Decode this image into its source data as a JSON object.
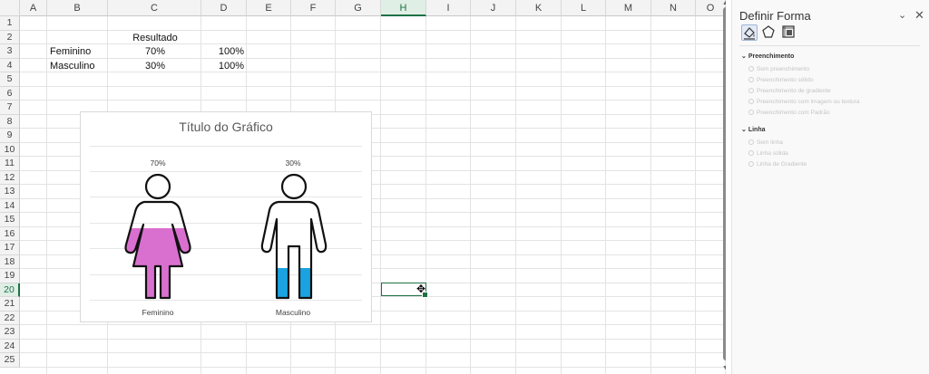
{
  "columns": [
    "A",
    "B",
    "C",
    "D",
    "E",
    "F",
    "G",
    "H",
    "I",
    "J",
    "K",
    "L",
    "M",
    "N",
    "O"
  ],
  "rows": [
    "1",
    "2",
    "3",
    "4",
    "5",
    "6",
    "7",
    "8",
    "9",
    "10",
    "11",
    "12",
    "13",
    "14",
    "15",
    "16",
    "17",
    "18",
    "19",
    "20",
    "21",
    "22",
    "23",
    "24",
    "25"
  ],
  "selected_cell": "H20",
  "cells": {
    "c2": "Resultado",
    "b3": "Feminino",
    "c3": "70%",
    "d3": "100%",
    "b4": "Masculino",
    "c4": "30%",
    "d4": "100%"
  },
  "chart": {
    "title": "Título do Gráfico",
    "female_color": "#d970cf",
    "male_color": "#1aa3e0"
  },
  "chart_data": {
    "type": "bar",
    "title": "Título do Gráfico",
    "categories": [
      "Feminino",
      "Masculino"
    ],
    "values": [
      0.7,
      0.3
    ],
    "data_labels": [
      "70%",
      "30%"
    ],
    "ylim": [
      0,
      1
    ],
    "grid": true
  },
  "pane": {
    "title": "Definir Forma",
    "tabs": [
      "fill-line-icon",
      "effects-pentagon-icon",
      "size-properties-icon"
    ],
    "fill_section": "Preenchimento",
    "fill_options": [
      "Sem preenchimento",
      "Preenchimento sólido",
      "Preenchimento de gradiente",
      "Preenchimento com imagem ou textura",
      "Preenchimento com Padrão"
    ],
    "line_section": "Linha",
    "line_options": [
      "Sem linha",
      "Linha sólida",
      "Linha de Gradiente"
    ]
  }
}
